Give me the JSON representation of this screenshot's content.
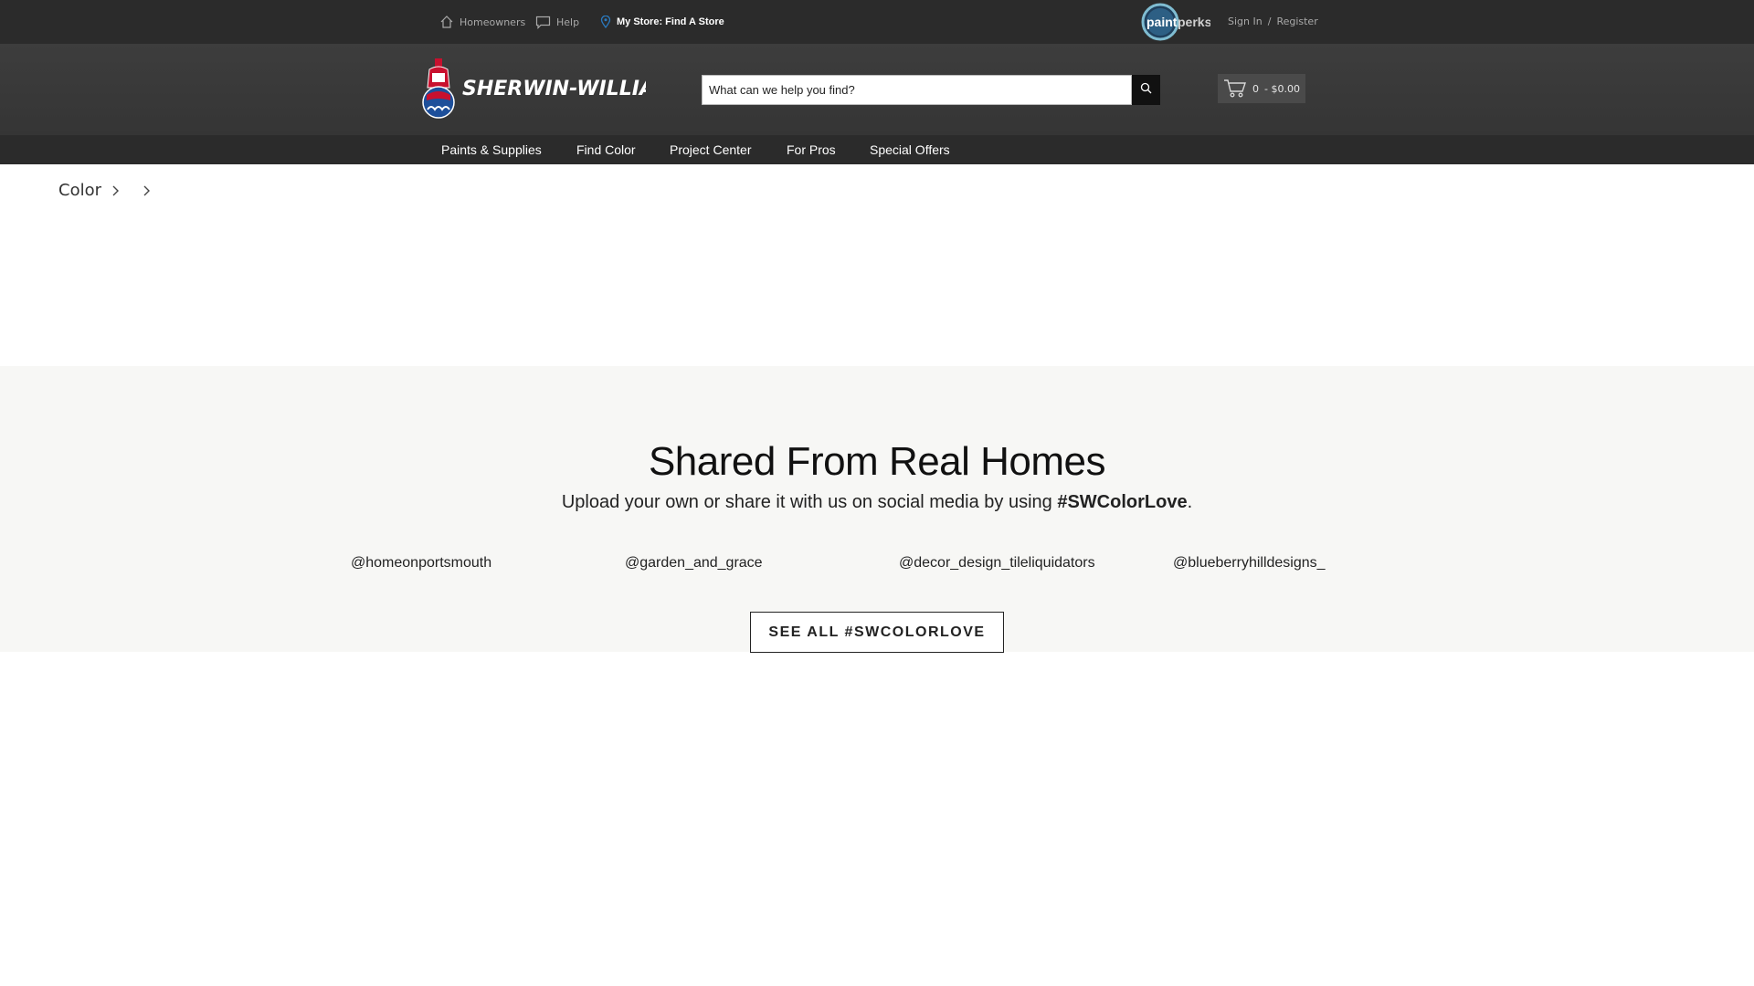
{
  "utility": {
    "homeowners": "Homeowners",
    "help": "Help",
    "store": "My Store: Find A Store",
    "sign_in": "Sign In",
    "separator": "/",
    "register": "Register",
    "paintperks_logo_text": "paintperks"
  },
  "header": {
    "logo_text": "SHERWIN-WILLIAMS.",
    "search_placeholder": "What can we help you find?",
    "cart_count": "0",
    "cart_total": "- $0.00"
  },
  "nav": {
    "items": [
      "Paints & Supplies",
      "Find Color",
      "Project Center",
      "For Pros",
      "Special Offers"
    ]
  },
  "breadcrumb": {
    "root": "Color"
  },
  "shared": {
    "title": "Shared From Real Homes",
    "subtitle_prefix": "Upload your own or share it with us on social media by using ",
    "hashtag": "#SWColorLove",
    "subtitle_suffix": ".",
    "handles": [
      "@homeonportsmouth",
      "@garden_and_grace",
      "@decor_design_tileliquidators",
      "@blueberryhilldesigns_"
    ],
    "see_all_label": "SEE ALL #SWCOLORLOVE"
  },
  "colors": {
    "top_bar": "#2b2b2b",
    "header": "#3a3a3a",
    "section_bg": "#f7f7f5",
    "store_pin": "#2a7ac0"
  }
}
